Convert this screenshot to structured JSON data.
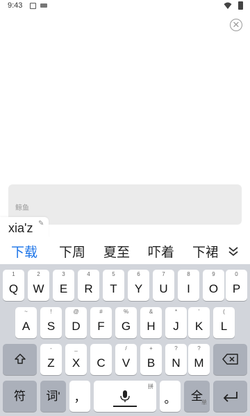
{
  "status": {
    "time": "9:43"
  },
  "input": {
    "placeholder": "鲸鱼"
  },
  "composing": {
    "text": "xia'z"
  },
  "candidates": [
    "下载",
    "下周",
    "夏至",
    "吓着",
    "下裙"
  ],
  "keyboard": {
    "row1": [
      {
        "label": "Q",
        "sub": "1"
      },
      {
        "label": "W",
        "sub": "2"
      },
      {
        "label": "E",
        "sub": "3"
      },
      {
        "label": "R",
        "sub": "4"
      },
      {
        "label": "T",
        "sub": "5"
      },
      {
        "label": "Y",
        "sub": "6"
      },
      {
        "label": "U",
        "sub": "7"
      },
      {
        "label": "I",
        "sub": "8"
      },
      {
        "label": "O",
        "sub": "9"
      },
      {
        "label": "P",
        "sub": "0"
      }
    ],
    "row2": [
      {
        "label": "A",
        "sub": "~"
      },
      {
        "label": "S",
        "sub": "!"
      },
      {
        "label": "D",
        "sub": "@"
      },
      {
        "label": "F",
        "sub": "#"
      },
      {
        "label": "G",
        "sub": "%"
      },
      {
        "label": "H",
        "sub": "&"
      },
      {
        "label": "J",
        "sub": "*"
      },
      {
        "label": "K",
        "sub": "'"
      },
      {
        "label": "L",
        "sub": "("
      }
    ],
    "row3": [
      {
        "label": "Z",
        "sub": "-"
      },
      {
        "label": "X",
        "sub": "_"
      },
      {
        "label": "C",
        "sub": ""
      },
      {
        "label": "V",
        "sub": "/"
      },
      {
        "label": "B",
        "sub": "+"
      },
      {
        "label": "N",
        "sub": "?"
      },
      {
        "label": "M",
        "sub": "?"
      }
    ],
    "symbol_label": "符",
    "word_label": "词'",
    "comma_label": "，",
    "period_label": "。",
    "pinyin_mark": "拼",
    "fullwidth_label": "全",
    "fullwidth_sub": "单"
  },
  "colors": {
    "accent": "#1a73e8",
    "keyboard_bg": "#d2d5db",
    "function_key": "#abb0ba"
  }
}
